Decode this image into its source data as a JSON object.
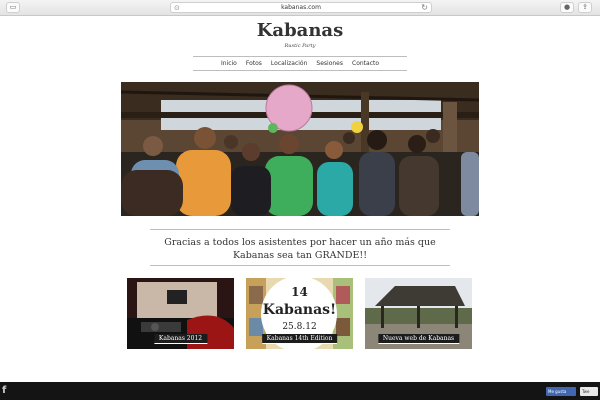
{
  "browser": {
    "url": "kabanas.com"
  },
  "site": {
    "title": "Kabanas",
    "subtitle": "Rustic Party"
  },
  "nav": {
    "items": [
      "Inicio",
      "Fotos",
      "Localización",
      "Sesiones",
      "Contacto"
    ]
  },
  "main": {
    "message": "Gracias a todos los asistentes por hacer un año más que Kabanas sea tan GRANDE!!"
  },
  "thumbnails": [
    {
      "caption": "Kabanas 2012"
    },
    {
      "caption": "Kabanas 14th Edition",
      "poster_line1": "14",
      "poster_line2": "Kabanas!",
      "poster_line3": "25.8.12"
    },
    {
      "caption": "Nueva web de Kabanas"
    }
  ],
  "social": {
    "fb_like_label": "Me gusta",
    "tweet_label": "Twe",
    "left_icon": "facebook-f"
  }
}
